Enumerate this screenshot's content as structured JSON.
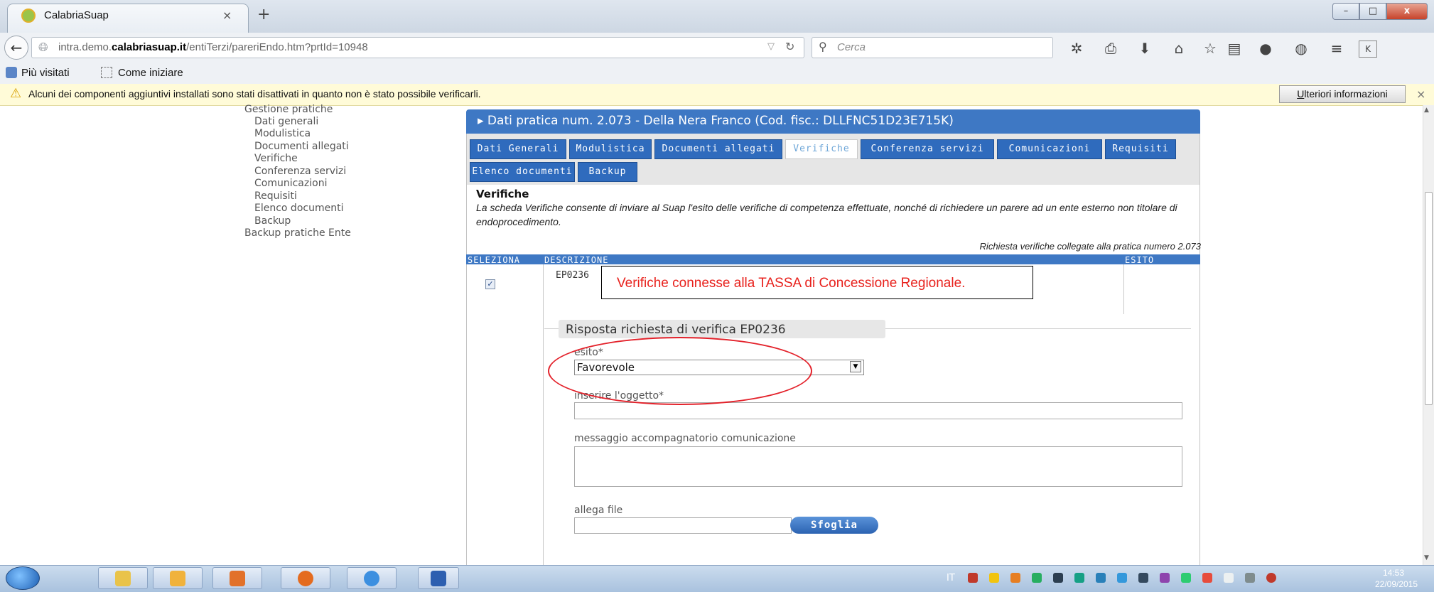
{
  "browser": {
    "tab_title": "CalabriaSuap",
    "tab_close": "×",
    "new_tab": "+",
    "url_prefix": "intra.demo.",
    "url_domain": "calabriasuap.it",
    "url_path": "/entiTerzi/pareriEndo.htm?prtId=10948",
    "search_placeholder": "Cerca",
    "bookmarks": [
      "Più visitati",
      "Come iniziare"
    ],
    "notice_text": "Alcuni dei componenti aggiuntivi installati sono stati disattivati in quanto non è stato possibile verificarli.",
    "notice_button": "Ulteriori informazioni",
    "notice_button_first": "U",
    "notice_button_rest": "lteriori informazioni",
    "win_min": "–",
    "win_max": "□",
    "win_close": "x"
  },
  "sidebar": {
    "items": [
      "Gestione pratiche",
      "Dati generali",
      "Modulistica",
      "Documenti allegati",
      "Verifiche",
      "Conferenza servizi",
      "Comunicazioni",
      "Requisiti",
      "Elenco documenti",
      "Backup",
      "Backup pratiche Ente"
    ]
  },
  "panel": {
    "title": "▸ Dati pratica num. 2.073 - Della Nera Franco  (Cod. fisc.: DLLFNC51D23E715K)",
    "tabs": [
      "Dati Generali",
      "Modulistica",
      "Documenti allegati",
      "Verifiche",
      "Conferenza servizi",
      "Comunicazioni",
      "Requisiti",
      "Elenco documenti",
      "Backup"
    ],
    "active_tab": "Verifiche",
    "section_title": "Verifiche",
    "section_desc": "La scheda Verifiche consente di inviare al Suap l'esito delle verifiche di competenza effettuate, nonché di richiedere un parere ad un ente esterno non titolare di endoprocedimento.",
    "request_line": "Richiesta verifiche collegate alla pratica numero 2.073",
    "table": {
      "headers": [
        "SELEZIONA",
        "DESCRIZIONE",
        "ESITO"
      ],
      "row_code": "EP0236",
      "checked": true,
      "check_glyph": "✓"
    },
    "annotation": "Verifiche connesse alla TASSA di Concessione Regionale.",
    "form": {
      "legend": "Risposta richiesta di verifica EP0236",
      "esito_label": "esito*",
      "esito_value": "Favorevole",
      "oggetto_label": "inserire l'oggetto*",
      "messaggio_label": "messaggio accompagnatorio comunicazione",
      "allega_label": "allega file",
      "sfoglia_button": "Sfoglia"
    }
  },
  "taskbar": {
    "lang": "IT",
    "time": "14:53",
    "date": "22/09/2015"
  },
  "colors": {
    "panel_blue": "#3e78c4",
    "annotation_red": "#e8211c",
    "notice_bg": "#fffbd8"
  }
}
